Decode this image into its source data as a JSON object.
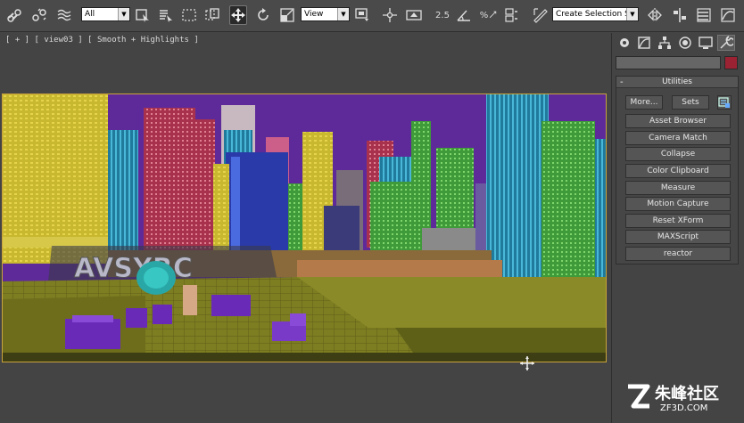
{
  "toolbar": {
    "selection_filter": "All",
    "reference_coord": "View",
    "snap_angle_label": "2.5",
    "percent_snap_label": "%",
    "named_selection_set": "Create Selection Se"
  },
  "viewport": {
    "label": "[ + ] [ view03 ] [ Smooth + Highlights ]"
  },
  "command_panel": {
    "tabs": [
      "create-icon",
      "modify-icon",
      "hierarchy-icon",
      "motion-icon",
      "display-icon",
      "utilities-icon"
    ],
    "active_tab": "utilities-icon",
    "object_color": "#9b2233",
    "rollout": {
      "title": "Utilities",
      "more_label": "More...",
      "sets_label": "Sets",
      "buttons": [
        "Asset Browser",
        "Camera Match",
        "Collapse",
        "Color Clipboard",
        "Measure",
        "Motion Capture",
        "Reset XForm",
        "MAXScript",
        "reactor"
      ]
    }
  },
  "watermark": {
    "text": "朱峰社区",
    "url": "ZF3D.COM"
  }
}
